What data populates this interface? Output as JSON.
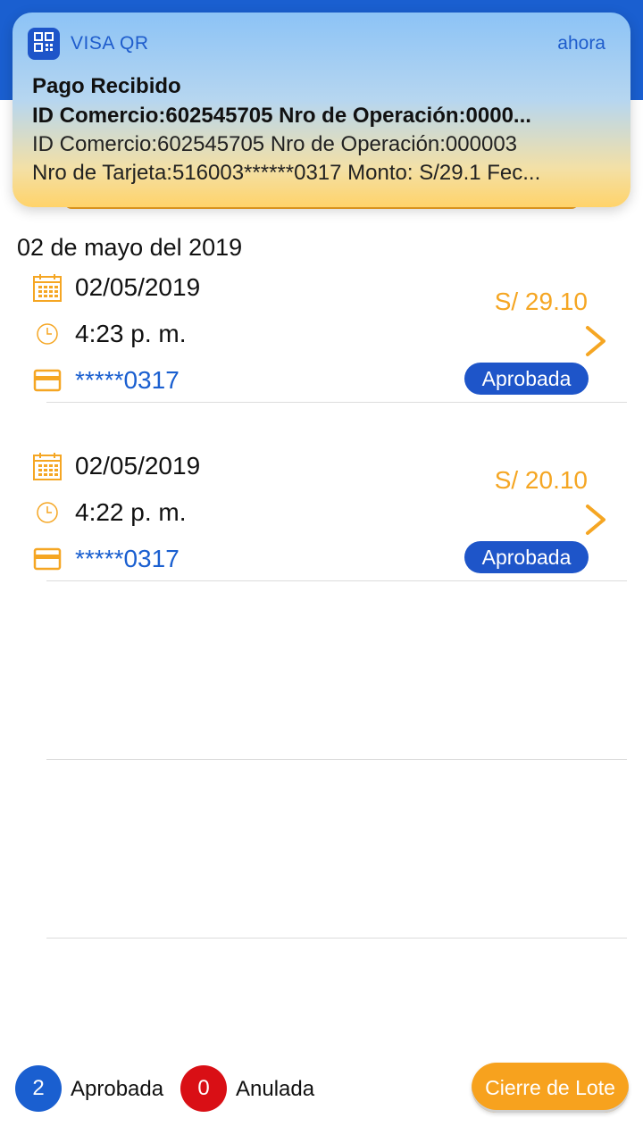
{
  "notification": {
    "app_name": "VISA QR",
    "time": "ahora",
    "title": "Pago Recibido",
    "subtitle": "ID Comercio:602545705 Nro de Operación:0000...",
    "body_line1": "ID Comercio:602545705 Nro de Operación:000003",
    "body_line2": "Nro de Tarjeta:516003******0317 Monto: S/29.1 Fec..."
  },
  "section": {
    "date_heading": "02 de mayo del 2019"
  },
  "transactions": [
    {
      "date": "02/05/2019",
      "time": "4:23 p. m.",
      "card": "*****0317",
      "amount": "S/ 29.10",
      "status": "Aprobada"
    },
    {
      "date": "02/05/2019",
      "time": "4:22 p. m.",
      "card": "*****0317",
      "amount": "S/ 20.10",
      "status": "Aprobada"
    }
  ],
  "footer": {
    "approved_count": "2",
    "approved_label": "Aprobada",
    "annulled_count": "0",
    "annulled_label": "Anulada",
    "close_batch_label": "Cierre de Lote"
  },
  "colors": {
    "brand_blue": "#1a5fd0",
    "accent_orange": "#f5a623",
    "annulled_red": "#d90f15"
  }
}
